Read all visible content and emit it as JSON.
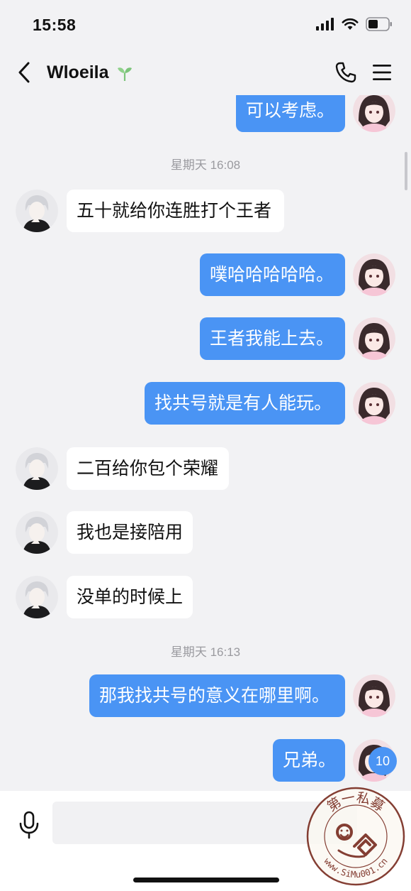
{
  "status_bar": {
    "time": "15:58",
    "icons": [
      "signal-icon",
      "wifi-icon",
      "battery-icon"
    ]
  },
  "nav": {
    "contact_name": "Wloeila",
    "icons": [
      "back-icon",
      "sprout-icon",
      "phone-icon",
      "menu-icon"
    ]
  },
  "messages": [
    {
      "type": "out",
      "text": "可以考虑。"
    },
    {
      "type": "timestamp",
      "text": "星期天 16:08"
    },
    {
      "type": "in",
      "text": "五十就给你连胜打个王者"
    },
    {
      "type": "out",
      "text": "噗哈哈哈哈哈。"
    },
    {
      "type": "out",
      "text": "王者我能上去。"
    },
    {
      "type": "out",
      "text": "找共号就是有人能玩。"
    },
    {
      "type": "in",
      "text": "二百给你包个荣耀"
    },
    {
      "type": "in",
      "text": "我也是接陪用"
    },
    {
      "type": "in",
      "text": "没单的时候上"
    },
    {
      "type": "timestamp",
      "text": "星期天 16:13"
    },
    {
      "type": "out",
      "text": "那我找共号的意义在哪里啊。"
    },
    {
      "type": "out",
      "text": "兄弟。"
    }
  ],
  "unread_badge": "10",
  "input": {
    "placeholder": ""
  },
  "watermark": {
    "text_top": "第一私募",
    "text_bottom": "www.SiMu001.cn"
  },
  "colors": {
    "outgoing_bubble": "#4a94f4",
    "incoming_bubble": "#ffffff",
    "background": "#f2f2f4"
  }
}
